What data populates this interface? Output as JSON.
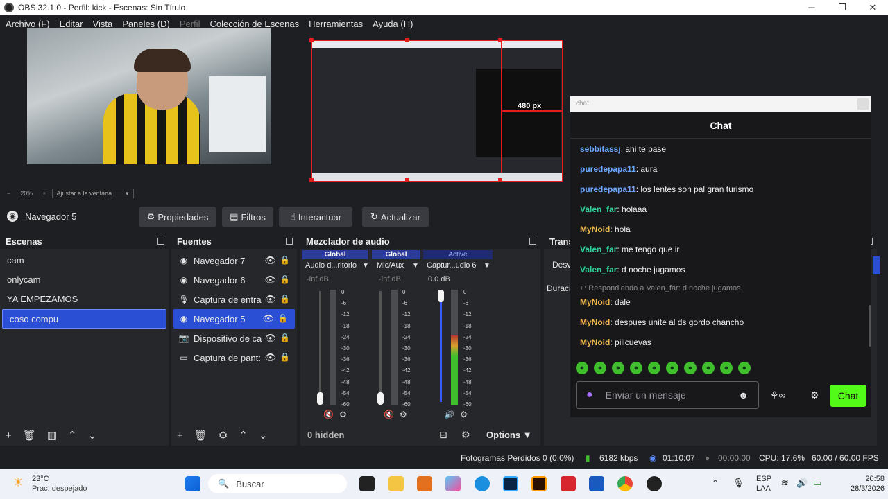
{
  "window": {
    "title": "OBS 32.1.0 - Perfil: kick - Escenas: Sin Título",
    "minimize": "─",
    "maximize": "❐",
    "close": "✕"
  },
  "menu": [
    {
      "label": "Archivo (F)",
      "enabled": true
    },
    {
      "label": "Editar",
      "enabled": true
    },
    {
      "label": "Vista",
      "enabled": true
    },
    {
      "label": "Paneles (D)",
      "enabled": true
    },
    {
      "label": "Perfil",
      "enabled": false
    },
    {
      "label": "Colección de Escenas",
      "enabled": true
    },
    {
      "label": "Herramientas",
      "enabled": true
    },
    {
      "label": "Ayuda (H)",
      "enabled": true
    }
  ],
  "preview": {
    "zoom_minus": "−",
    "zoom": "20%",
    "zoom_plus": "+",
    "fit_label": "Ajustar a la ventana",
    "size_label": "480 px"
  },
  "context": {
    "source_name": "Navegador 5",
    "properties": "Propiedades",
    "filters": "Filtros",
    "interact": "Interactuar",
    "refresh": "Actualizar"
  },
  "scenes": {
    "title": "Escenas",
    "items": [
      "cam",
      "onlycam",
      "YA EMPEZAMOS",
      "coso compu"
    ],
    "selected_index": 3
  },
  "sources": {
    "title": "Fuentes",
    "items": [
      {
        "name": "Navegador 7",
        "icon": "globe-icon"
      },
      {
        "name": "Navegador 6",
        "icon": "globe-icon"
      },
      {
        "name": "Captura de entra",
        "icon": "microphone-icon"
      },
      {
        "name": "Navegador 5",
        "icon": "globe-icon"
      },
      {
        "name": "Dispositivo de ca",
        "icon": "camera-icon"
      },
      {
        "name": "Captura de pant:",
        "icon": "monitor-icon"
      }
    ],
    "selected_index": 3
  },
  "mixer": {
    "title": "Mezclador de audio",
    "hidden_label": "0 hidden",
    "options_label": "Options",
    "ticks": [
      "0",
      "-6",
      "-12",
      "-18",
      "-24",
      "-30",
      "-36",
      "-42",
      "-48",
      "-54",
      "-60"
    ],
    "channels": [
      {
        "tag": "Global",
        "name": "Audio d...ritorio",
        "db": "-inf dB",
        "muted": true,
        "level": 0
      },
      {
        "tag": "Global",
        "name": "Mic/Aux",
        "db": "-inf dB",
        "muted": true,
        "level": 0
      },
      {
        "tag": "Active",
        "name": "Captur...udio 6",
        "db": "0.0 dB",
        "muted": false,
        "level": 0.6
      }
    ]
  },
  "transitions": {
    "title": "Trans",
    "select": "Desv",
    "duration_label": "Duraci"
  },
  "chat": {
    "placeholder_top": "chat",
    "title": "Chat",
    "messages": [
      {
        "user": "sebbitassj",
        "text": "ahi te pase",
        "color": "#6fa8ff"
      },
      {
        "user": "puredepapa11",
        "text": "aura",
        "color": "#6fa8ff"
      },
      {
        "user": "puredepapa11",
        "text": "los lentes son pal gran turismo",
        "color": "#6fa8ff"
      },
      {
        "user": "Valen_far",
        "text": "holaaa",
        "color": "#2fd39a"
      },
      {
        "user": "MyNoid",
        "text": "hola",
        "color": "#f0b84a"
      },
      {
        "user": "Valen_far",
        "text": "me tengo que ir",
        "color": "#2fd39a"
      },
      {
        "user": "Valen_far",
        "text": "d noche jugamos",
        "color": "#2fd39a"
      },
      {
        "user": "MyNoid",
        "text": "dale",
        "color": "#f0b84a",
        "reply": "Respondiendo a Valen_far: d noche jugamos"
      },
      {
        "user": "MyNoid",
        "text": "despues unite al ds gordo chancho",
        "color": "#f0b84a"
      },
      {
        "user": "MyNoid",
        "text": "pilicuevas",
        "color": "#f0b84a"
      }
    ],
    "input_placeholder": "Enviar un mensaje",
    "send_label": "Chat",
    "accent": "#53fc18"
  },
  "status": {
    "dropped": "Fotogramas Perdidos 0 (0.0%)",
    "bitrate": "6182 kbps",
    "stream_time": "01:10:07",
    "rec_time": "00:00:00",
    "cpu": "CPU: 17.6%",
    "fps": "60.00 / 60.00 FPS"
  },
  "taskbar": {
    "temp": "23°C",
    "weather": "Prac. despejado",
    "search": "Buscar",
    "lang1": "ESP",
    "lang2": "LAA",
    "time": "20:58",
    "date": "28/3/2026"
  }
}
